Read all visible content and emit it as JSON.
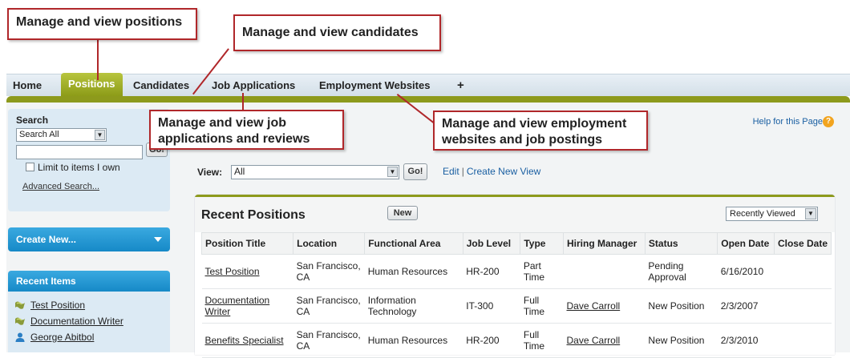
{
  "callouts": {
    "positions": "Manage and view positions",
    "candidates": "Manage and view candidates",
    "job_applications": "Manage and view job applications and reviews",
    "employment_websites": "Manage and view employment websites and job postings"
  },
  "tabs": [
    {
      "label": "Home"
    },
    {
      "label": "Positions"
    },
    {
      "label": "Candidates"
    },
    {
      "label": "Job Applications"
    },
    {
      "label": "Employment Websites"
    },
    {
      "label": "+"
    }
  ],
  "sidebar": {
    "search_title": "Search",
    "search_scope": "Search All",
    "search_value": "",
    "go_label": "Go!",
    "limit_label": "Limit to items I own",
    "advanced_link": "Advanced Search...",
    "create_new": "Create New...",
    "recent_title": "Recent Items",
    "recent_items": [
      {
        "label": "Test Position",
        "icon": "position-icon"
      },
      {
        "label": "Documentation Writer",
        "icon": "position-icon"
      },
      {
        "label": "George Abitbol",
        "icon": "person-icon"
      }
    ]
  },
  "main": {
    "help_link": "Help for this Page",
    "view_label": "View:",
    "view_value": "All",
    "go_label": "Go!",
    "edit_link": "Edit",
    "create_view_link": "Create New View",
    "panel_title": "Recent Positions",
    "new_button": "New",
    "sort_select": "Recently Viewed",
    "columns": [
      "Position Title",
      "Location",
      "Functional Area",
      "Job Level",
      "Type",
      "Hiring Manager",
      "Status",
      "Open Date",
      "Close Date"
    ],
    "rows": [
      [
        "Test Position",
        "San Francisco, CA",
        "Human Resources",
        "HR-200",
        "Part Time",
        "",
        "Pending Approval",
        "6/16/2010",
        ""
      ],
      [
        "Documentation Writer",
        "San Francisco, CA",
        "Information Technology",
        "IT-300",
        "Full Time",
        "Dave Carroll",
        "New Position",
        "2/3/2007",
        ""
      ],
      [
        "Benefits Specialist",
        "San Francisco, CA",
        "Human Resources",
        "HR-200",
        "Full Time",
        "Dave Carroll",
        "New Position",
        "2/3/2010",
        ""
      ]
    ]
  },
  "colors": {
    "accent": "#8d9a1c",
    "callout_border": "#b0272a",
    "link": "#1a5fa2",
    "sidebar": "#dceaf4"
  }
}
